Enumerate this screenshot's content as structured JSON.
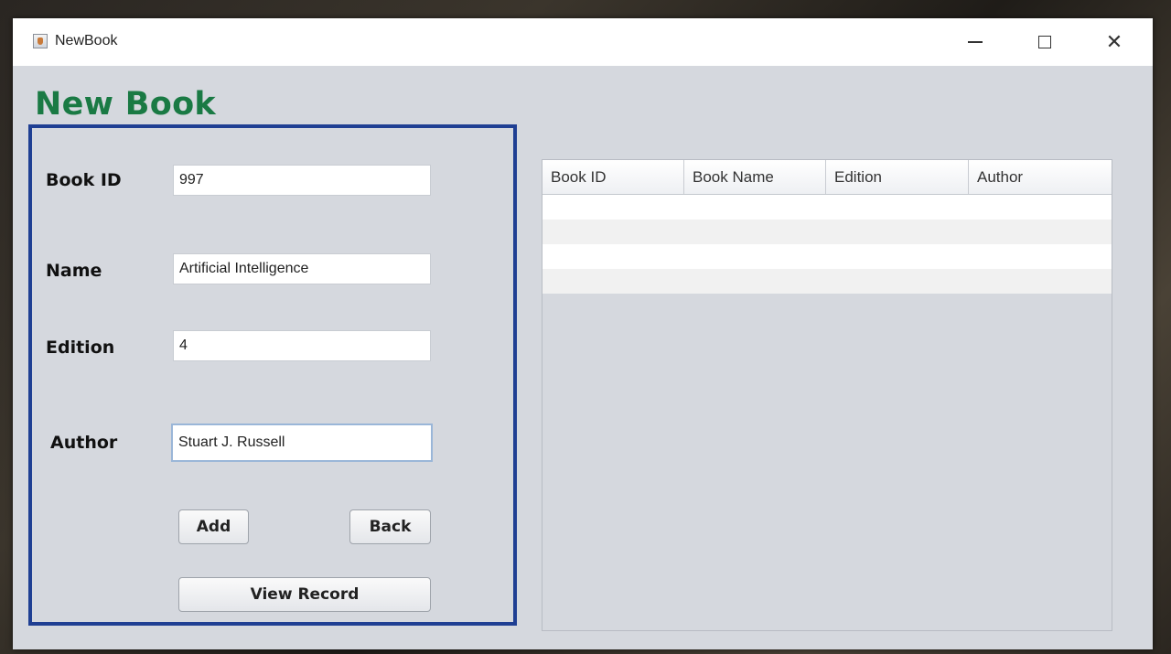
{
  "window": {
    "title": "NewBook"
  },
  "heading": "New Book",
  "form": {
    "book_id": {
      "label": "Book ID",
      "value": "997"
    },
    "name": {
      "label": "Name",
      "value": "Artificial Intelligence"
    },
    "edition": {
      "label": "Edition",
      "value": "4"
    },
    "author": {
      "label": "Author",
      "value": "Stuart J. Russell"
    }
  },
  "buttons": {
    "add": "Add",
    "back": "Back",
    "view_record": "View Record"
  },
  "table": {
    "columns": [
      "Book ID",
      "Book Name",
      "Edition",
      "Author"
    ],
    "rows": [
      [
        "",
        "",
        "",
        ""
      ],
      [
        "",
        "",
        "",
        ""
      ],
      [
        "",
        "",
        "",
        ""
      ],
      [
        "",
        "",
        "",
        ""
      ]
    ]
  },
  "colors": {
    "heading": "#1a7a44",
    "panel_border": "#1f3f93",
    "background": "#d5d8de"
  }
}
